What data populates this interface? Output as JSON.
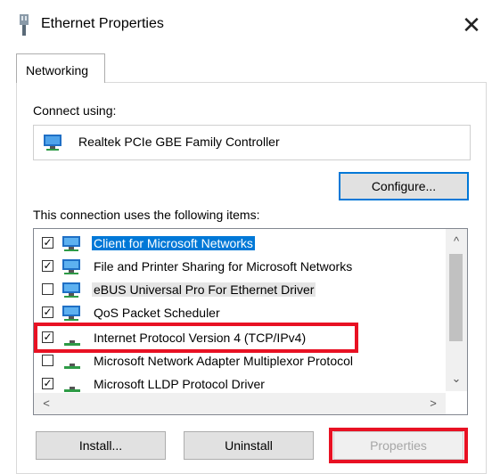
{
  "window": {
    "title": "Ethernet Properties",
    "close": "✕"
  },
  "tabs": [
    {
      "label": "Networking"
    }
  ],
  "connect_using": {
    "label": "Connect using:",
    "adapter": "Realtek PCIe GBE Family Controller"
  },
  "configure_button": {
    "label": "Configure..."
  },
  "items_label": "This connection uses the following items:",
  "items": [
    {
      "label": "Client for Microsoft Networks",
      "checked": true
    },
    {
      "label": "File and Printer Sharing for Microsoft Networks",
      "checked": true
    },
    {
      "label": "eBUS Universal Pro For Ethernet Driver",
      "checked": false
    },
    {
      "label": "QoS Packet Scheduler",
      "checked": true
    },
    {
      "label": "Internet Protocol Version 4 (TCP/IPv4)",
      "checked": true
    },
    {
      "label": "Microsoft Network Adapter Multiplexor Protocol",
      "checked": false
    },
    {
      "label": "Microsoft LLDP Protocol Driver",
      "checked": true
    }
  ],
  "scroll_arrows": {
    "up": "^",
    "down": "⌄",
    "left": "<",
    "right": ">"
  },
  "buttons": {
    "install": "Install...",
    "uninstall": "Uninstall",
    "properties": "Properties"
  },
  "colors": {
    "highlight": "#e81123",
    "selection": "#0078d7"
  }
}
